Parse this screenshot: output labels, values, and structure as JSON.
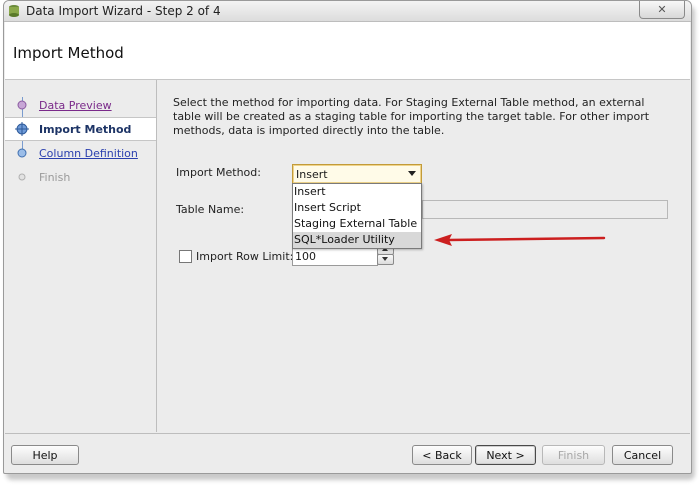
{
  "window": {
    "title": "Data Import Wizard - Step 2 of 4",
    "close_icon": "close-icon"
  },
  "header": {
    "title": "Import Method"
  },
  "nav": {
    "items": [
      {
        "label": "Data Preview",
        "state": "visited"
      },
      {
        "label": "Import Method",
        "state": "current"
      },
      {
        "label": "Column Definition",
        "state": "link"
      },
      {
        "label": "Finish",
        "state": "disabled"
      }
    ]
  },
  "content": {
    "description": "Select the method for importing data.  For Staging External Table method, an external table will be created as a staging table for importing the target table.  For other import methods, data is imported directly into the table.",
    "import_method": {
      "label": "Import Method:",
      "value": "Insert",
      "options": [
        "Insert",
        "Insert Script",
        "Staging External Table",
        "SQL*Loader Utility"
      ],
      "highlighted": "SQL*Loader Utility"
    },
    "table_name": {
      "label": "Table Name:",
      "value": ""
    },
    "row_limit": {
      "label": "Import Row Limit:",
      "checked": false,
      "value": "100"
    }
  },
  "annotation": {
    "color": "#cc1f1f"
  },
  "footer": {
    "help": "Help",
    "back": "< Back",
    "next": "Next >",
    "finish": "Finish",
    "cancel": "Cancel"
  }
}
